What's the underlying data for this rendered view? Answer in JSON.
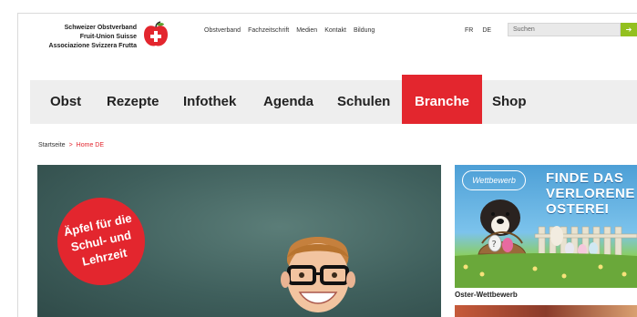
{
  "header": {
    "logo_lines": [
      "Schweizer Obstverband",
      "Fruit-Union Suisse",
      "Associazione Svizzera Frutta"
    ],
    "logo_icon": "apple-cross-icon",
    "topnav": [
      "Obstverband",
      "Fachzeitschrift",
      "Medien",
      "Kontakt",
      "Bildung"
    ],
    "languages": [
      "FR",
      "DE"
    ],
    "search_placeholder": "Suchen",
    "search_button": "➔"
  },
  "mainnav": {
    "items": [
      "Obst",
      "Rezepte",
      "Infothek",
      "Agenda",
      "Schulen",
      "Branche",
      "Shop"
    ],
    "active": "Branche"
  },
  "breadcrumb": {
    "home": "Startseite",
    "separator": ">",
    "current": "Home DE"
  },
  "hero": {
    "badge_text": "Äpfel für die Schul- und Lehrzeit"
  },
  "sidebar": {
    "promo_tag": "Wettbewerb",
    "promo_title_lines": [
      "FINDE DAS",
      "VERLORENE",
      "OSTEREI"
    ],
    "promo_caption": "Oster-Wettbewerb"
  },
  "colors": {
    "brand_red": "#e3262e",
    "search_green": "#93c01f",
    "nav_bg": "#eeeeee"
  }
}
